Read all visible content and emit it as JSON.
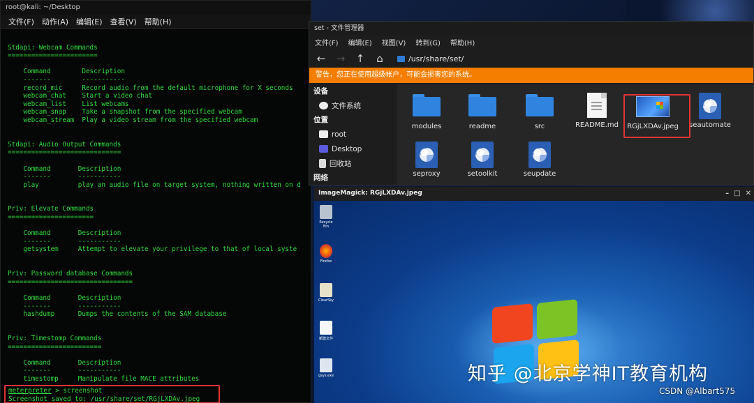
{
  "terminal": {
    "title": "root@kali: ~/Desktop",
    "menu": [
      "文件(F)",
      "动作(A)",
      "编辑(E)",
      "查看(V)",
      "帮助(H)"
    ],
    "lines": [
      "",
      "Stdapi: Webcam Commands",
      "=======================",
      "",
      "    Command        Description",
      "    -------        -----------",
      "    record_mic     Record audio from the default microphone for X seconds",
      "    webcam_chat    Start a video chat",
      "    webcam_list    List webcams",
      "    webcam_snap    Take a snapshot from the specified webcam",
      "    webcam_stream  Play a video stream from the specified webcam",
      "",
      "",
      "Stdapi: Audio Output Commands",
      "=============================",
      "",
      "    Command       Description",
      "    -------       -----------",
      "    play          play an audio file on target system, nothing written on d",
      "",
      "",
      "Priv: Elevate Commands",
      "======================",
      "",
      "    Command       Description",
      "    -------       -----------",
      "    getsystem     Attempt to elevate your privilege to that of local syste",
      "",
      "",
      "Priv: Password database Commands",
      "================================",
      "",
      "    Command       Description",
      "    -------       -----------",
      "    hashdump      Dumps the contents of the SAM database",
      "",
      "",
      "Priv: Timestomp Commands",
      "========================",
      "",
      "    Command       Description",
      "    -------       -----------",
      "    timestomp     Manipulate file MACE attributes"
    ],
    "prompt_name": "meterpreter",
    "prompt_cmd": " > screenshot",
    "saved_line": "Screenshot saved to: /usr/share/set/RGjLXDAv.jpeg"
  },
  "file_manager": {
    "title": "set - 文件管理器",
    "menu": [
      "文件(F)",
      "编辑(E)",
      "视图(V)",
      "转到(G)",
      "帮助(H)"
    ],
    "path": "/usr/share/set/",
    "warning": "警告，您正在使用超级帐户，可能会损害您的系统。",
    "sidebar": {
      "devices_header": "设备",
      "devices": [
        "文件系统"
      ],
      "places_header": "位置",
      "places": [
        "root",
        "Desktop",
        "回收站"
      ],
      "network_header": "网络"
    },
    "items": [
      {
        "label": "modules",
        "kind": "folder"
      },
      {
        "label": "readme",
        "kind": "folder"
      },
      {
        "label": "src",
        "kind": "folder"
      },
      {
        "label": "README.md",
        "kind": "doc"
      },
      {
        "label": "RGjLXDAv.jpeg",
        "kind": "image"
      },
      {
        "label": "seautomate",
        "kind": "python"
      },
      {
        "label": "seproxy",
        "kind": "python"
      },
      {
        "label": "setoolkit",
        "kind": "python"
      },
      {
        "label": "seupdate",
        "kind": "python"
      }
    ]
  },
  "imagemagick": {
    "title": "ImageMagick: RGjLXDAv.jpeg",
    "desktop_icons": [
      "Recycle Bin",
      "Firefox",
      "ClearSky",
      "新建文件",
      "gsys.exe"
    ]
  },
  "watermark": "知乎 @北京学神IT教育机构",
  "csdn": "CSDN @Albart575",
  "colors": {
    "terminal_text": "#2fdc3a",
    "warning": "#f57d00",
    "highlight": "#e23434",
    "folder": "#2f84e0"
  }
}
